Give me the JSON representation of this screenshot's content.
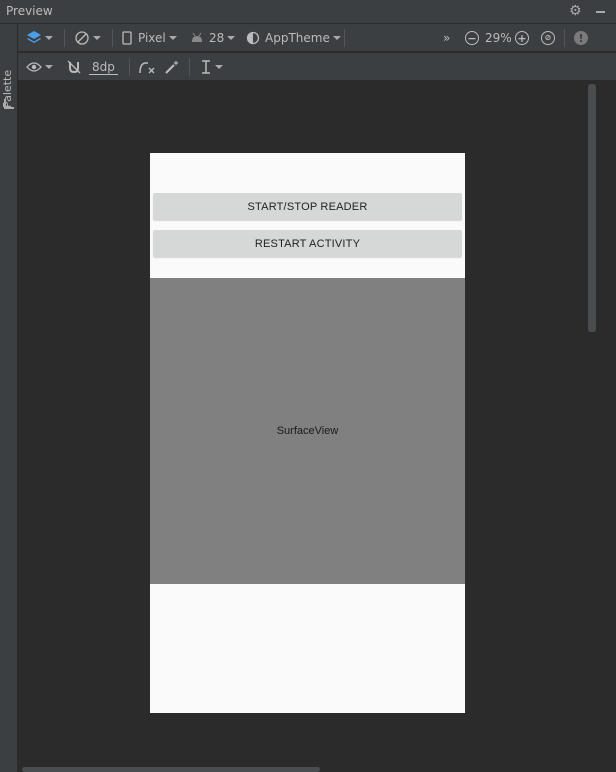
{
  "panel": {
    "title": "Preview",
    "palette_label": "Palette"
  },
  "toolbar": {
    "device": "Pixel",
    "api_level": "28",
    "theme": "AppTheme",
    "zoom": "29%",
    "margin": "8dp",
    "overflow": "»"
  },
  "phone": {
    "buttons": [
      "START/STOP READER",
      "RESTART ACTIVITY"
    ],
    "surface_label": "SurfaceView"
  },
  "colors": {
    "accent": "#4a9ee8",
    "ide_bg": "#2b2b2b",
    "panel_bg": "#3c3f41",
    "surface": "#808080",
    "button": "#d6d7d7"
  }
}
